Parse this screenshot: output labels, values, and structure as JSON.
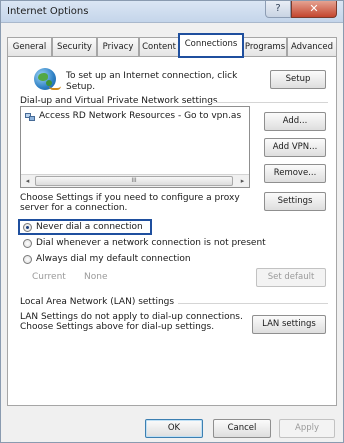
{
  "window": {
    "title": "Internet Options",
    "help_label": "?",
    "close_label": "✕"
  },
  "tabs": [
    {
      "label": "General"
    },
    {
      "label": "Security"
    },
    {
      "label": "Privacy"
    },
    {
      "label": "Content"
    },
    {
      "label": "Connections",
      "active": true
    },
    {
      "label": "Programs"
    },
    {
      "label": "Advanced"
    }
  ],
  "setup": {
    "text_line1": "To set up an Internet connection, click",
    "text_line2": "Setup.",
    "button": "Setup"
  },
  "dialup": {
    "section_title": "Dial-up and Virtual Private Network settings",
    "list_items": [
      "Access RD Network Resources - Go to vpn.as"
    ],
    "scroll_thumb": "III",
    "scroll_left": "◂",
    "scroll_right": "▸",
    "add_button": "Add...",
    "add_vpn_button": "Add VPN...",
    "remove_button": "Remove...",
    "settings_text_line1": "Choose Settings if you need to configure a proxy",
    "settings_text_line2": "server for a connection.",
    "settings_button": "Settings",
    "options": [
      {
        "label": "Never dial a connection",
        "checked": true
      },
      {
        "label": "Dial whenever a network connection is not present",
        "checked": false
      },
      {
        "label": "Always dial my default connection",
        "checked": false
      }
    ],
    "current_label": "Current",
    "current_value": "None",
    "set_default_button": "Set default"
  },
  "lan": {
    "section_title": "Local Area Network (LAN) settings",
    "text_line1": "LAN Settings do not apply to dial-up connections.",
    "text_line2": "Choose Settings above for dial-up settings.",
    "button": "LAN settings"
  },
  "footer": {
    "ok": "OK",
    "cancel": "Cancel",
    "apply": "Apply"
  },
  "colors": {
    "highlight": "#1f4f9e",
    "title_bar": "#c4d5ea",
    "close_button": "#c4452e"
  }
}
